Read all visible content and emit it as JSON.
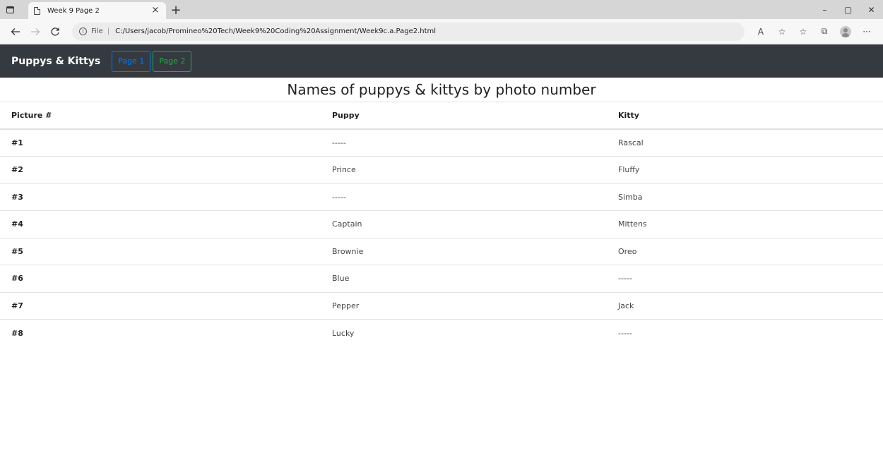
{
  "browser": {
    "tab_title": "Week 9 Page 2",
    "tab_close": "×",
    "new_tab": "+",
    "window_controls": {
      "minimize": "–",
      "maximize": "▢",
      "close": "✕"
    },
    "address": {
      "scheme_label": "File",
      "separator": "|",
      "url": "C:/Users/jacob/Promineo%20Tech/Week9%20Coding%20Assignment/Week9c.a.Page2.html"
    },
    "toolbar_icons": {
      "read_aloud": "A",
      "favorite_add": "☆",
      "favorites": "☆",
      "collections": "⧉",
      "more": "···"
    }
  },
  "navbar": {
    "brand": "Puppys & Kittys",
    "buttons": [
      {
        "label": "Page 1"
      },
      {
        "label": "Page 2"
      }
    ]
  },
  "main": {
    "heading": "Names of puppys & kittys by photo number",
    "table": {
      "headers": [
        "Picture #",
        "Puppy",
        "Kitty"
      ],
      "rows": [
        [
          "#1",
          "-----",
          "Rascal"
        ],
        [
          "#2",
          "Prince",
          "Fluffy"
        ],
        [
          "#3",
          "-----",
          "Simba"
        ],
        [
          "#4",
          "Captain",
          "Mittens"
        ],
        [
          "#5",
          "Brownie",
          "Oreo"
        ],
        [
          "#6",
          "Blue",
          "-----"
        ],
        [
          "#7",
          "Pepper",
          "Jack"
        ],
        [
          "#8",
          "Lucky",
          "-----"
        ]
      ]
    }
  },
  "colors": {
    "navbar_bg": "#343a40",
    "primary": "#007bff",
    "success": "#28a745"
  }
}
